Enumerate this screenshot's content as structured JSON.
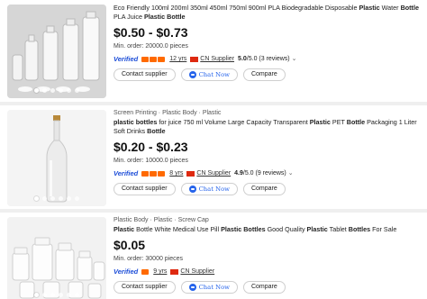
{
  "listings": [
    {
      "categories": "",
      "title_parts": [
        {
          "t": "Eco Friendly 100ml 200ml 350ml 450ml 750ml 900ml PLA Biodegradable Disposable ",
          "b": false
        },
        {
          "t": "Plastic",
          "b": true
        },
        {
          "t": " Water ",
          "b": false
        },
        {
          "t": "Bottle",
          "b": true
        },
        {
          "t": " PLA Juice ",
          "b": false
        },
        {
          "t": "Plastic Bottle",
          "b": true
        }
      ],
      "price": "$0.50 - $0.73",
      "min_order": "Min. order: 20000.0 pieces",
      "verified": "Verified",
      "years": "12 yrs",
      "country": "CN Supplier",
      "rating_score": "5.0",
      "rating_rest": "/5.0 (3 reviews)",
      "contact": "Contact supplier",
      "chat": "Chat Now",
      "compare": "Compare"
    },
    {
      "categories": "Screen Printing · Plastic Body · Plastic",
      "title_parts": [
        {
          "t": "plastic bottles",
          "b": true
        },
        {
          "t": " for juice 750 ml Volume Large Capacity Transparent ",
          "b": false
        },
        {
          "t": "Plastic",
          "b": true
        },
        {
          "t": " PET ",
          "b": false
        },
        {
          "t": "Bottle",
          "b": true
        },
        {
          "t": " Packaging 1 Liter Soft Drinks ",
          "b": false
        },
        {
          "t": "Bottle",
          "b": true
        }
      ],
      "price": "$0.20 - $0.23",
      "min_order": "Min. order: 10000.0 pieces",
      "verified": "Verified",
      "years": "8 yrs",
      "country": "CN Supplier",
      "rating_score": "4.9",
      "rating_rest": "/5.0 (9 reviews)",
      "contact": "Contact supplier",
      "chat": "Chat Now",
      "compare": "Compare"
    },
    {
      "categories": "Plastic Body · Plastic · Screw Cap",
      "title_parts": [
        {
          "t": "Plastic",
          "b": true
        },
        {
          "t": " Bottle White Medical Use Pill ",
          "b": false
        },
        {
          "t": "Plastic Bottles",
          "b": true
        },
        {
          "t": " Good Quality ",
          "b": false
        },
        {
          "t": "Plastic",
          "b": true
        },
        {
          "t": " Tablet ",
          "b": false
        },
        {
          "t": "Bottles",
          "b": true
        },
        {
          "t": " For Sale",
          "b": false
        }
      ],
      "price": "$0.05",
      "min_order": "Min. order: 30000 pieces",
      "verified": "Verified",
      "years": "9 yrs",
      "country": "CN Supplier",
      "rating_score": "",
      "rating_rest": "",
      "contact": "Contact supplier",
      "chat": "Chat Now",
      "compare": "Compare"
    }
  ],
  "colors": {
    "verified_blue": "#1d4ed8",
    "badge_orange": "#ff6a00",
    "chat_blue": "#2563eb"
  }
}
